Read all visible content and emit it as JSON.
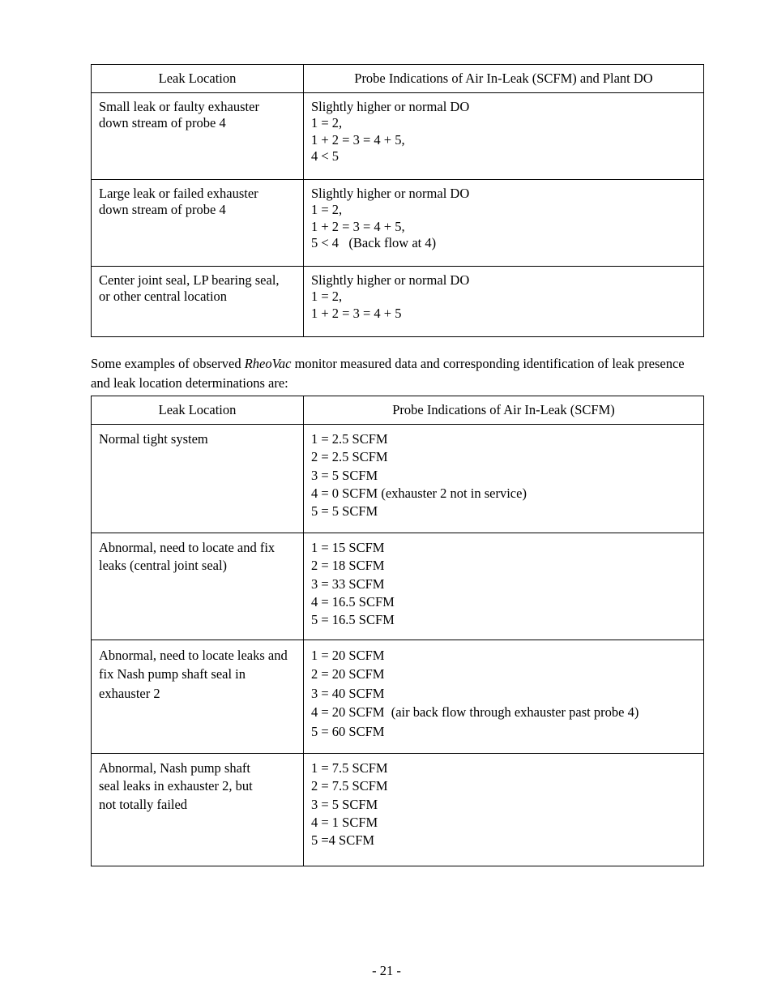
{
  "document": {
    "page_number": "- 21 -",
    "paragraph": {
      "before_italic": "Some examples of observed ",
      "italic": "RheoVac",
      "after_italic": " monitor measured data and corresponding identification of leak presence and leak location determinations are:"
    }
  },
  "table1": {
    "headers": {
      "left": "Leak Location",
      "right": "Probe Indications of Air In-Leak (SCFM) and Plant DO"
    },
    "rows": [
      {
        "location": [
          "Small leak or faulty exhauster",
          "down stream of probe 4"
        ],
        "indications": [
          "Slightly higher or normal DO",
          "1 = 2,",
          "1 + 2 = 3 = 4 + 5,",
          "4 < 5"
        ]
      },
      {
        "location": [
          "Large leak or failed exhauster",
          "down stream of probe 4"
        ],
        "indications": [
          "Slightly higher or normal DO",
          "1 = 2,",
          "1 + 2 = 3 = 4 + 5,",
          "5 < 4   (Back flow at 4)"
        ]
      },
      {
        "location": [
          "Center joint seal, LP bearing seal,",
          "or other central location"
        ],
        "indications": [
          "Slightly higher or normal DO",
          "1 = 2,",
          "1 + 2 = 3 = 4 + 5"
        ]
      }
    ]
  },
  "table2": {
    "headers": {
      "left": "Leak Location",
      "right": "Probe Indications of Air In-Leak (SCFM)"
    },
    "rows": [
      {
        "location": [
          "Normal tight system"
        ],
        "indications": [
          "1 = 2.5 SCFM",
          "2 = 2.5 SCFM",
          "3 = 5 SCFM",
          "4 = 0 SCFM (exhauster 2 not in service)",
          "5 = 5 SCFM"
        ]
      },
      {
        "location": [
          "Abnormal, need to locate and fix",
          "leaks (central joint seal)"
        ],
        "indications": [
          "1 = 15 SCFM",
          "2 = 18 SCFM",
          "3 = 33 SCFM",
          "4 = 16.5 SCFM",
          "5 = 16.5 SCFM"
        ]
      },
      {
        "location": [
          "Abnormal, need to locate leaks and",
          "fix Nash pump shaft seal in",
          "exhauster 2"
        ],
        "indications": [
          "1 = 20 SCFM",
          "2 = 20 SCFM",
          "3 = 40 SCFM",
          "4 = 20 SCFM  (air back flow through exhauster past probe 4)",
          "5 = 60 SCFM"
        ]
      },
      {
        "location": [
          "Abnormal, Nash pump shaft",
          "seal leaks in exhauster 2, but",
          "not totally failed"
        ],
        "indications": [
          "1 = 7.5 SCFM",
          "2 = 7.5 SCFM",
          "3 = 5 SCFM",
          "4 = 1 SCFM",
          "5 =4 SCFM"
        ]
      }
    ]
  }
}
